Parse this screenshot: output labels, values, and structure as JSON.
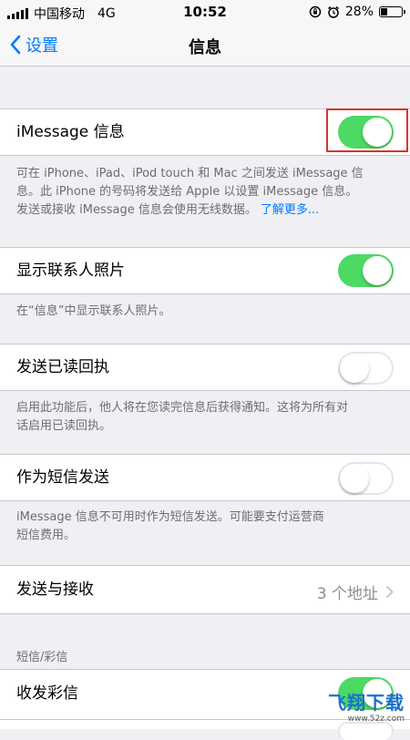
{
  "status_bar": {
    "carrier": "中国移动",
    "network": "4G",
    "time": "10:52",
    "battery": "28%",
    "battery_level": 0.28
  },
  "nav": {
    "back_label": "设置",
    "title": "信息"
  },
  "imessage": {
    "label": "iMessage 信息",
    "toggle_on": true,
    "footer_line1": "可在 iPhone、iPad、iPod touch 和 Mac 之间发送 iMessage 信",
    "footer_line2": "息。此 iPhone 的号码将发送给 Apple 以设置 iMessage 信息。",
    "footer_line3": "发送或接收 iMessage 信息会使用无线数据。",
    "footer_link": "了解更多..."
  },
  "show_contact_photos": {
    "label": "显示联系人照片",
    "toggle_on": true,
    "footer": "在“信息”中显示联系人照片。"
  },
  "read_receipts": {
    "label": "发送已读回执",
    "toggle_on": false,
    "footer_line1": "启用此功能后，他人将在您读完信息后获得通知。这将为所有对",
    "footer_line2": "话启用已读回执。"
  },
  "send_as_sms": {
    "label": "作为短信发送",
    "toggle_on": false,
    "footer_line1": "iMessage 信息不可用时作为短信发送。可能要支付运营商",
    "footer_line2": "短信费用。"
  },
  "send_receive": {
    "label": "发送与接收",
    "value": "3 个地址"
  },
  "sms_mms_section": {
    "header": "短信/彩信"
  },
  "mms_messaging": {
    "label": "收发彩信",
    "toggle_on": true
  },
  "watermark": {
    "main": "飞翔下载",
    "sub": "www.52z.com"
  },
  "colors": {
    "accent": "#007aff",
    "toggle_on": "#4cd964",
    "highlight": "#d9342b"
  }
}
